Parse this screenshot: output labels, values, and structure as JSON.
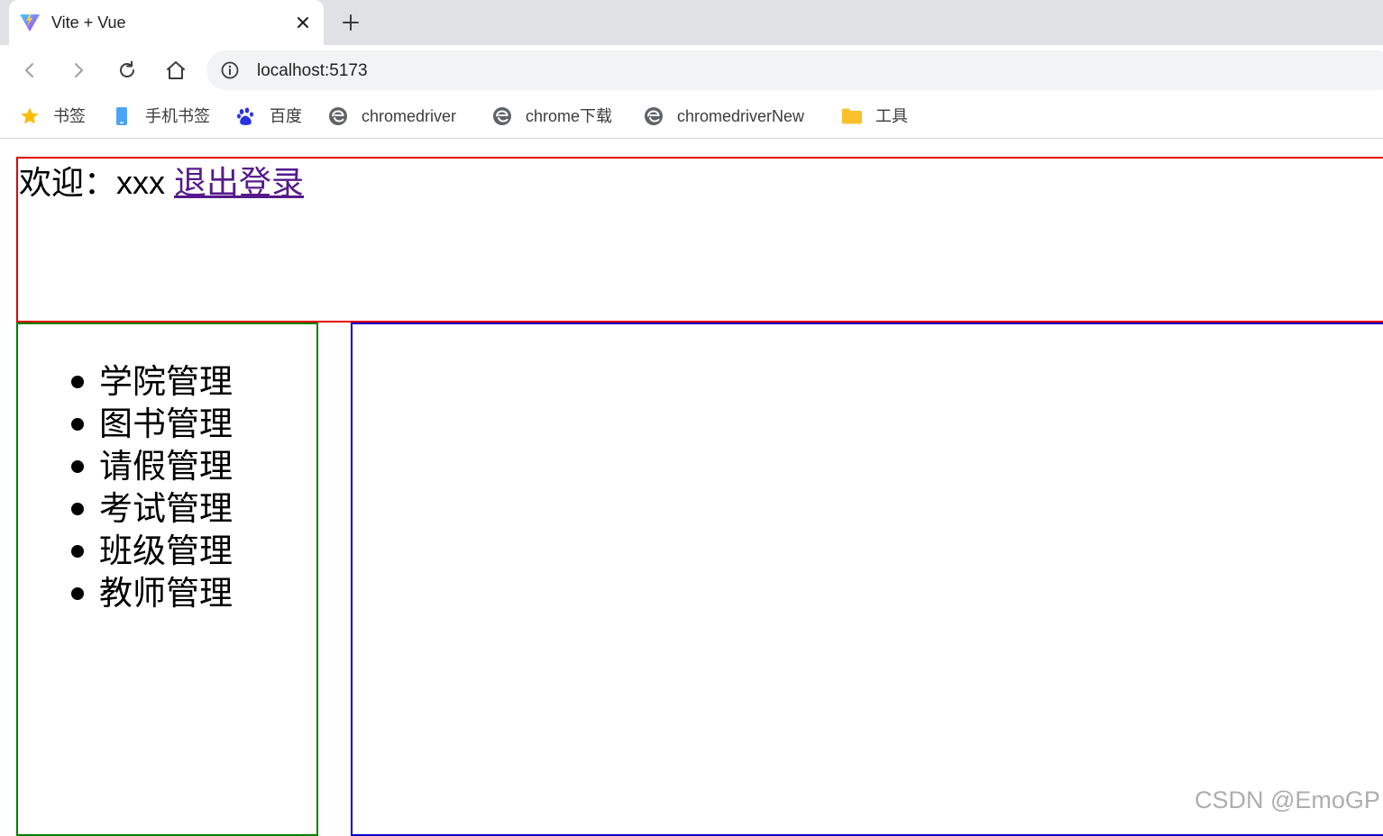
{
  "browser": {
    "tab": {
      "title": "Vite + Vue",
      "favicon": "vite-logo-icon",
      "close_icon": "close-icon"
    },
    "new_tab_icon": "plus-icon",
    "toolbar": {
      "back_icon": "back-arrow-icon",
      "forward_icon": "forward-arrow-icon",
      "reload_icon": "reload-icon",
      "home_icon": "home-icon",
      "site_info_icon": "info-icon",
      "url": "localhost:5173"
    },
    "bookmarks": [
      {
        "label": "书签",
        "icon": "star-icon"
      },
      {
        "label": "手机书签",
        "icon": "phone-icon"
      },
      {
        "label": "百度",
        "icon": "baidu-paw-icon"
      },
      {
        "label": "chromedriver",
        "icon": "edge-icon"
      },
      {
        "label": "chrome下载",
        "icon": "edge-icon"
      },
      {
        "label": "chromedriverNew",
        "icon": "edge-icon"
      },
      {
        "label": "工具",
        "icon": "folder-icon"
      }
    ]
  },
  "page": {
    "header": {
      "welcome_text": "欢迎：xxx",
      "logout_link": "退出登录"
    },
    "sidebar": {
      "menu": [
        {
          "label": "学院管理"
        },
        {
          "label": "图书管理"
        },
        {
          "label": "请假管理"
        },
        {
          "label": "考试管理"
        },
        {
          "label": "班级管理"
        },
        {
          "label": "教师管理"
        }
      ]
    }
  },
  "watermark": "CSDN @EmoGP",
  "colors": {
    "header_border": "#e00000",
    "sidebar_border": "#008000",
    "main_border": "#0000c8",
    "link": "#551a8b",
    "tabstrip_bg": "#dfe1e5",
    "omnibox_bg": "#f1f3f4"
  }
}
